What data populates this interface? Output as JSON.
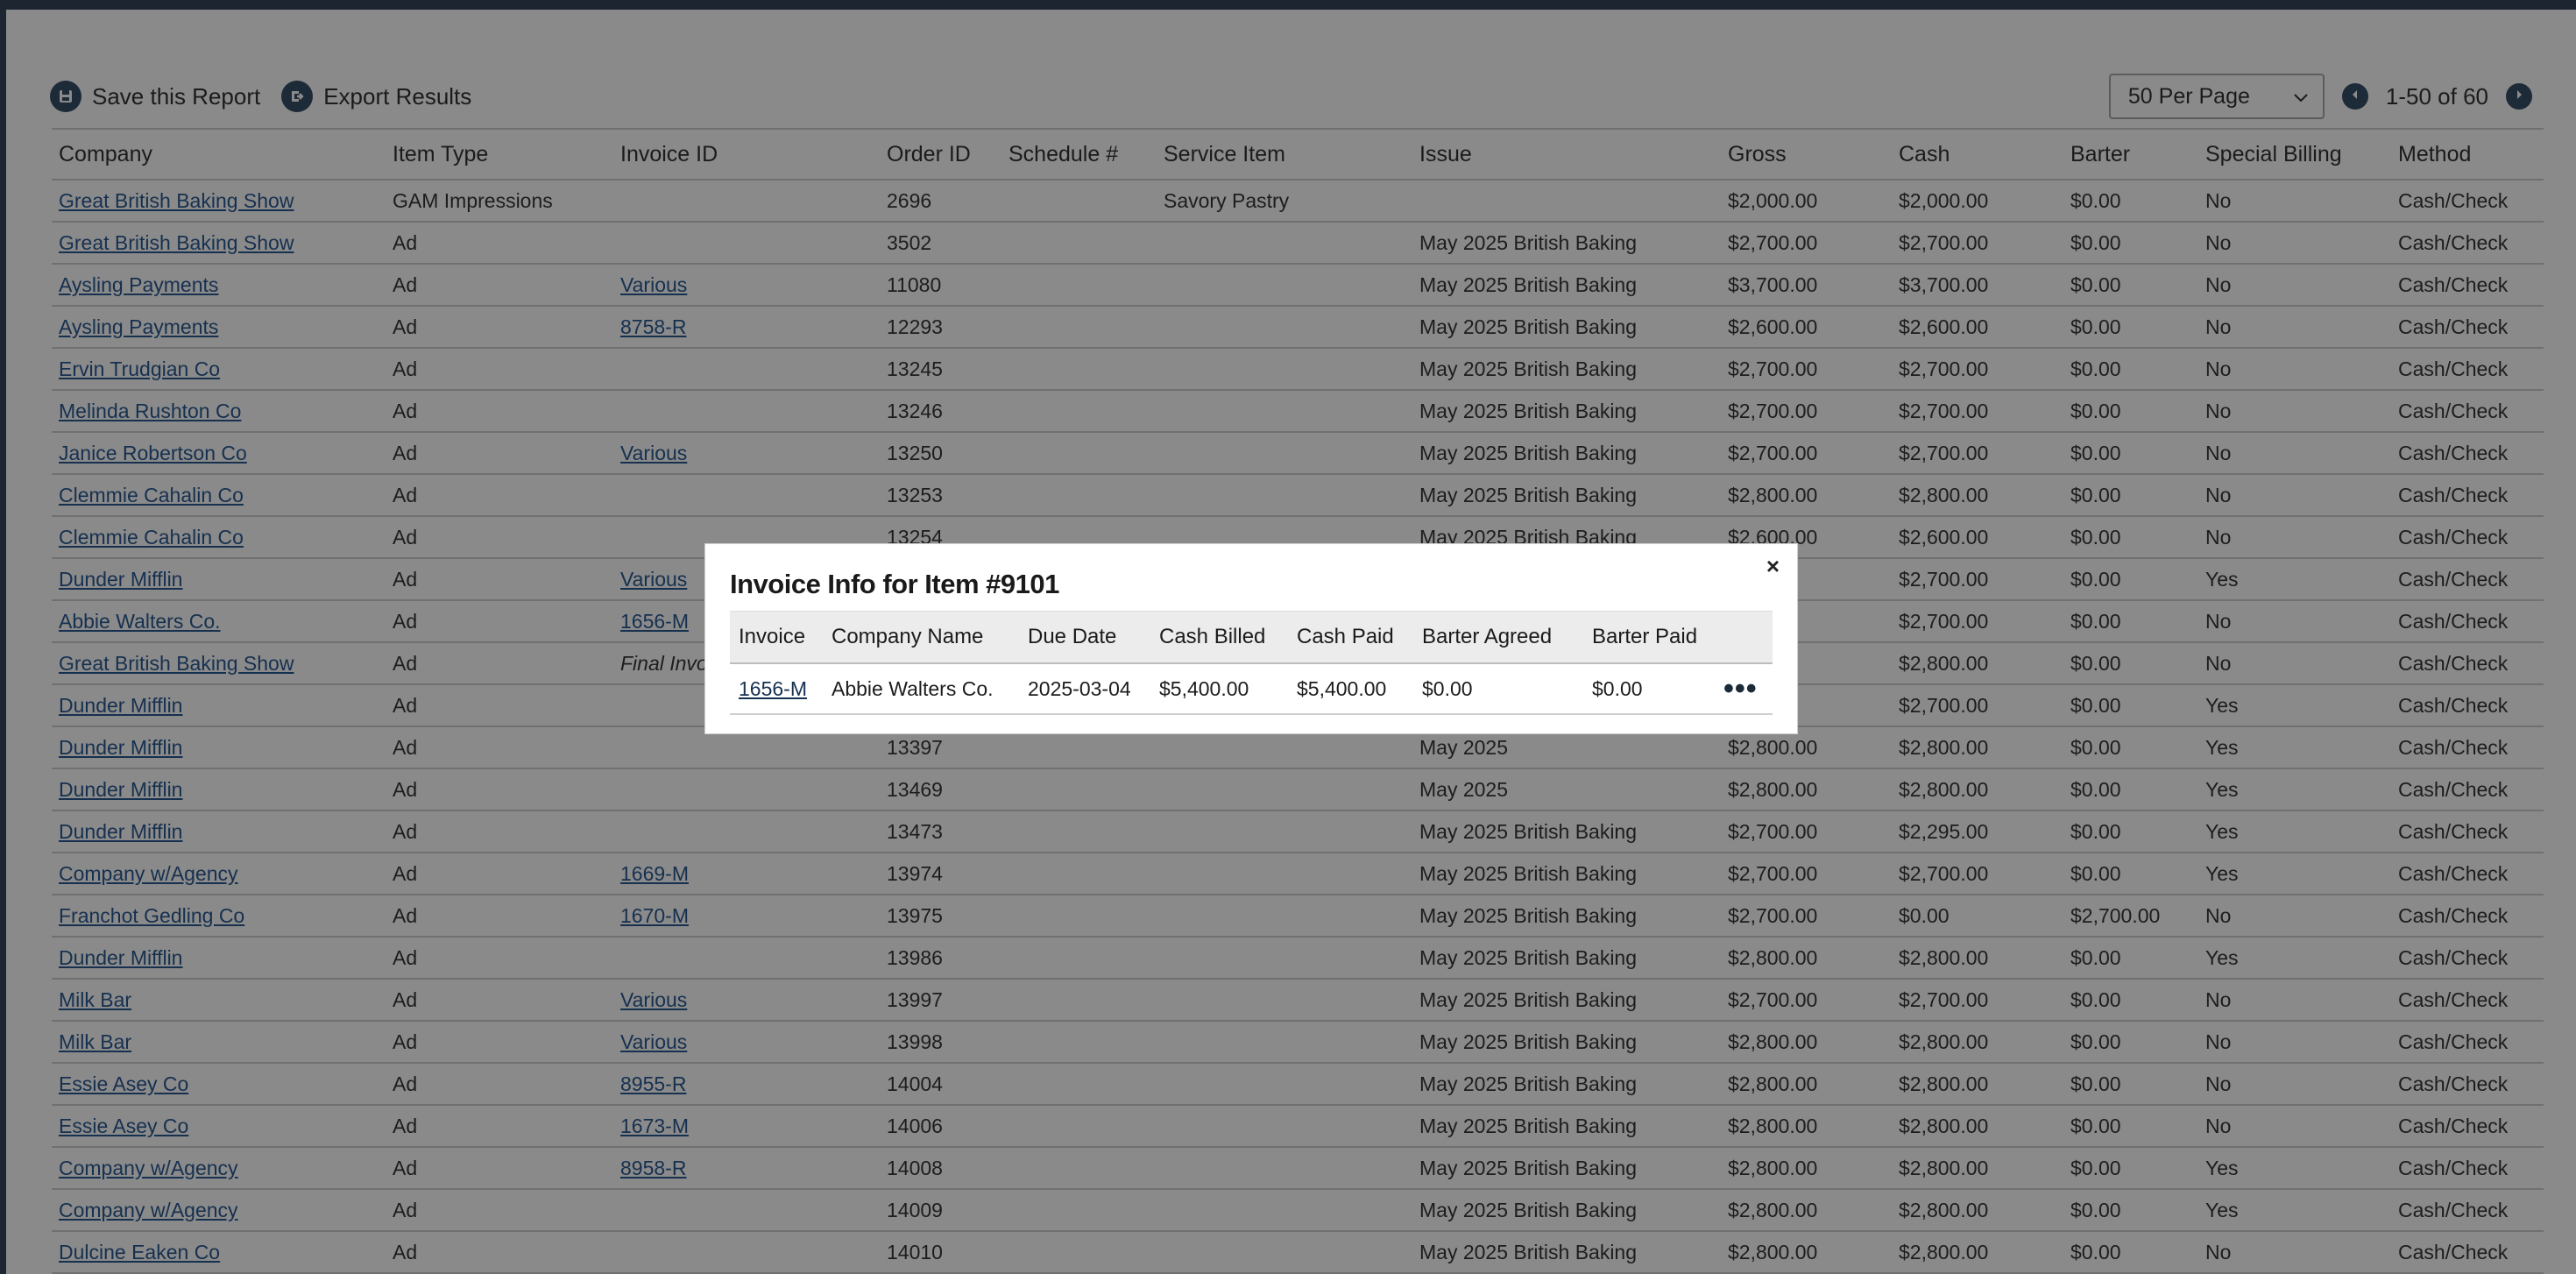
{
  "toolbar": {
    "save_label": "Save this Report",
    "export_label": "Export Results"
  },
  "pager": {
    "per_page": "50 Per Page",
    "count": "1-50 of 60"
  },
  "report": {
    "columns": [
      "Company",
      "Item Type",
      "Invoice ID",
      "Order ID",
      "Schedule #",
      "Service Item",
      "Issue",
      "Gross",
      "Cash",
      "Barter",
      "Special Billing",
      "Method"
    ],
    "rows": [
      {
        "company": "Great British Baking Show",
        "type": "GAM Impressions",
        "invoice": "",
        "order": "2696",
        "schedule": "",
        "service": "Savory Pastry",
        "issue": "",
        "gross": "$2,000.00",
        "cash": "$2,000.00",
        "barter": "$0.00",
        "special": "No",
        "method": "Cash/Check"
      },
      {
        "company": "Great British Baking Show",
        "type": "Ad",
        "invoice": "",
        "order": "3502",
        "schedule": "",
        "service": "",
        "issue": "May 2025 British Baking",
        "gross": "$2,700.00",
        "cash": "$2,700.00",
        "barter": "$0.00",
        "special": "No",
        "method": "Cash/Check"
      },
      {
        "company": "Aysling Payments",
        "type": "Ad",
        "invoice": "Various",
        "order": "11080",
        "schedule": "",
        "service": "",
        "issue": "May 2025 British Baking",
        "gross": "$3,700.00",
        "cash": "$3,700.00",
        "barter": "$0.00",
        "special": "No",
        "method": "Cash/Check"
      },
      {
        "company": "Aysling Payments",
        "type": "Ad",
        "invoice": "8758-R",
        "order": "12293",
        "schedule": "",
        "service": "",
        "issue": "May 2025 British Baking",
        "gross": "$2,600.00",
        "cash": "$2,600.00",
        "barter": "$0.00",
        "special": "No",
        "method": "Cash/Check"
      },
      {
        "company": "Ervin Trudgian Co",
        "type": "Ad",
        "invoice": "",
        "order": "13245",
        "schedule": "",
        "service": "",
        "issue": "May 2025 British Baking",
        "gross": "$2,700.00",
        "cash": "$2,700.00",
        "barter": "$0.00",
        "special": "No",
        "method": "Cash/Check"
      },
      {
        "company": "Melinda Rushton Co",
        "type": "Ad",
        "invoice": "",
        "order": "13246",
        "schedule": "",
        "service": "",
        "issue": "May 2025 British Baking",
        "gross": "$2,700.00",
        "cash": "$2,700.00",
        "barter": "$0.00",
        "special": "No",
        "method": "Cash/Check"
      },
      {
        "company": "Janice Robertson Co",
        "type": "Ad",
        "invoice": "Various",
        "order": "13250",
        "schedule": "",
        "service": "",
        "issue": "May 2025 British Baking",
        "gross": "$2,700.00",
        "cash": "$2,700.00",
        "barter": "$0.00",
        "special": "No",
        "method": "Cash/Check"
      },
      {
        "company": "Clemmie Cahalin Co",
        "type": "Ad",
        "invoice": "",
        "order": "13253",
        "schedule": "",
        "service": "",
        "issue": "May 2025 British Baking",
        "gross": "$2,800.00",
        "cash": "$2,800.00",
        "barter": "$0.00",
        "special": "No",
        "method": "Cash/Check"
      },
      {
        "company": "Clemmie Cahalin Co",
        "type": "Ad",
        "invoice": "",
        "order": "13254",
        "schedule": "",
        "service": "",
        "issue": "May 2025 British Baking",
        "gross": "$2,600.00",
        "cash": "$2,600.00",
        "barter": "$0.00",
        "special": "No",
        "method": "Cash/Check"
      },
      {
        "company": "Dunder Mifflin",
        "type": "Ad",
        "invoice": "Various",
        "order": "",
        "schedule": "",
        "service": "",
        "issue": "",
        "gross": "",
        "cash": "$2,700.00",
        "barter": "$0.00",
        "special": "Yes",
        "method": "Cash/Check"
      },
      {
        "company": "Abbie Walters Co.",
        "type": "Ad",
        "invoice": "1656-M",
        "order": "",
        "schedule": "",
        "service": "",
        "issue": "",
        "gross": "",
        "cash": "$2,700.00",
        "barter": "$0.00",
        "special": "No",
        "method": "Cash/Check"
      },
      {
        "company": "Great British Baking Show",
        "type": "Ad",
        "invoice": "Final Invo",
        "invoice_italic": true,
        "order": "",
        "schedule": "",
        "service": "",
        "issue": "",
        "gross": "",
        "cash": "$2,800.00",
        "barter": "$0.00",
        "special": "No",
        "method": "Cash/Check"
      },
      {
        "company": "Dunder Mifflin",
        "type": "Ad",
        "invoice": "",
        "order": "",
        "schedule": "",
        "service": "",
        "issue": "",
        "gross": "",
        "cash": "$2,700.00",
        "barter": "$0.00",
        "special": "Yes",
        "method": "Cash/Check"
      },
      {
        "company": "Dunder Mifflin",
        "type": "Ad",
        "invoice": "",
        "order": "13397",
        "schedule": "",
        "service": "",
        "issue": "May 2025",
        "gross": "$2,800.00",
        "cash": "$2,800.00",
        "barter": "$0.00",
        "special": "Yes",
        "method": "Cash/Check"
      },
      {
        "company": "Dunder Mifflin",
        "type": "Ad",
        "invoice": "",
        "order": "13469",
        "schedule": "",
        "service": "",
        "issue": "May 2025",
        "gross": "$2,800.00",
        "cash": "$2,800.00",
        "barter": "$0.00",
        "special": "Yes",
        "method": "Cash/Check"
      },
      {
        "company": "Dunder Mifflin",
        "type": "Ad",
        "invoice": "",
        "order": "13473",
        "schedule": "",
        "service": "",
        "issue": "May 2025 British Baking",
        "gross": "$2,700.00",
        "cash": "$2,295.00",
        "barter": "$0.00",
        "special": "Yes",
        "method": "Cash/Check"
      },
      {
        "company": "Company w/Agency",
        "type": "Ad",
        "invoice": "1669-M",
        "order": "13974",
        "schedule": "",
        "service": "",
        "issue": "May 2025 British Baking",
        "gross": "$2,700.00",
        "cash": "$2,700.00",
        "barter": "$0.00",
        "special": "Yes",
        "method": "Cash/Check"
      },
      {
        "company": "Franchot Gedling Co",
        "type": "Ad",
        "invoice": "1670-M",
        "order": "13975",
        "schedule": "",
        "service": "",
        "issue": "May 2025 British Baking",
        "gross": "$2,700.00",
        "cash": "$0.00",
        "barter": "$2,700.00",
        "special": "No",
        "method": "Cash/Check"
      },
      {
        "company": "Dunder Mifflin",
        "type": "Ad",
        "invoice": "",
        "order": "13986",
        "schedule": "",
        "service": "",
        "issue": "May 2025 British Baking",
        "gross": "$2,800.00",
        "cash": "$2,800.00",
        "barter": "$0.00",
        "special": "Yes",
        "method": "Cash/Check"
      },
      {
        "company": "Milk Bar",
        "type": "Ad",
        "invoice": "Various",
        "order": "13997",
        "schedule": "",
        "service": "",
        "issue": "May 2025 British Baking",
        "gross": "$2,700.00",
        "cash": "$2,700.00",
        "barter": "$0.00",
        "special": "No",
        "method": "Cash/Check"
      },
      {
        "company": "Milk Bar",
        "type": "Ad",
        "invoice": "Various",
        "order": "13998",
        "schedule": "",
        "service": "",
        "issue": "May 2025 British Baking",
        "gross": "$2,800.00",
        "cash": "$2,800.00",
        "barter": "$0.00",
        "special": "No",
        "method": "Cash/Check"
      },
      {
        "company": "Essie Asey Co",
        "type": "Ad",
        "invoice": "8955-R",
        "order": "14004",
        "schedule": "",
        "service": "",
        "issue": "May 2025 British Baking",
        "gross": "$2,800.00",
        "cash": "$2,800.00",
        "barter": "$0.00",
        "special": "No",
        "method": "Cash/Check"
      },
      {
        "company": "Essie Asey Co",
        "type": "Ad",
        "invoice": "1673-M",
        "order": "14006",
        "schedule": "",
        "service": "",
        "issue": "May 2025 British Baking",
        "gross": "$2,800.00",
        "cash": "$2,800.00",
        "barter": "$0.00",
        "special": "No",
        "method": "Cash/Check"
      },
      {
        "company": "Company w/Agency",
        "type": "Ad",
        "invoice": "8958-R",
        "order": "14008",
        "schedule": "",
        "service": "",
        "issue": "May 2025 British Baking",
        "gross": "$2,800.00",
        "cash": "$2,800.00",
        "barter": "$0.00",
        "special": "Yes",
        "method": "Cash/Check"
      },
      {
        "company": "Company w/Agency",
        "type": "Ad",
        "invoice": "",
        "order": "14009",
        "schedule": "",
        "service": "",
        "issue": "May 2025 British Baking",
        "gross": "$2,800.00",
        "cash": "$2,800.00",
        "barter": "$0.00",
        "special": "Yes",
        "method": "Cash/Check"
      },
      {
        "company": "Dulcine Eaken Co",
        "type": "Ad",
        "invoice": "",
        "order": "14010",
        "schedule": "",
        "service": "",
        "issue": "May 2025 British Baking",
        "gross": "$2,800.00",
        "cash": "$2,800.00",
        "barter": "$0.00",
        "special": "No",
        "method": "Cash/Check"
      }
    ]
  },
  "modal": {
    "title": "Invoice Info for Item #9101",
    "close": "×",
    "columns": [
      "Invoice",
      "Company Name",
      "Due Date",
      "Cash Billed",
      "Cash Paid",
      "Barter Agreed",
      "Barter Paid"
    ],
    "row": {
      "invoice": "1656-M",
      "company": "Abbie Walters Co.",
      "due": "2025-03-04",
      "cash_billed": "$5,400.00",
      "cash_paid": "$5,400.00",
      "barter_agreed": "$0.00",
      "barter_paid": "$0.00"
    },
    "more": "•••"
  },
  "icons": {
    "save": "save-icon",
    "export": "export-icon",
    "prev": "chevron-left-icon",
    "next": "chevron-right-icon",
    "dropdown": "chevron-down-icon"
  },
  "colors": {
    "overlay": "#838383",
    "header_dark": "#1c2530",
    "link": "#16304f"
  }
}
